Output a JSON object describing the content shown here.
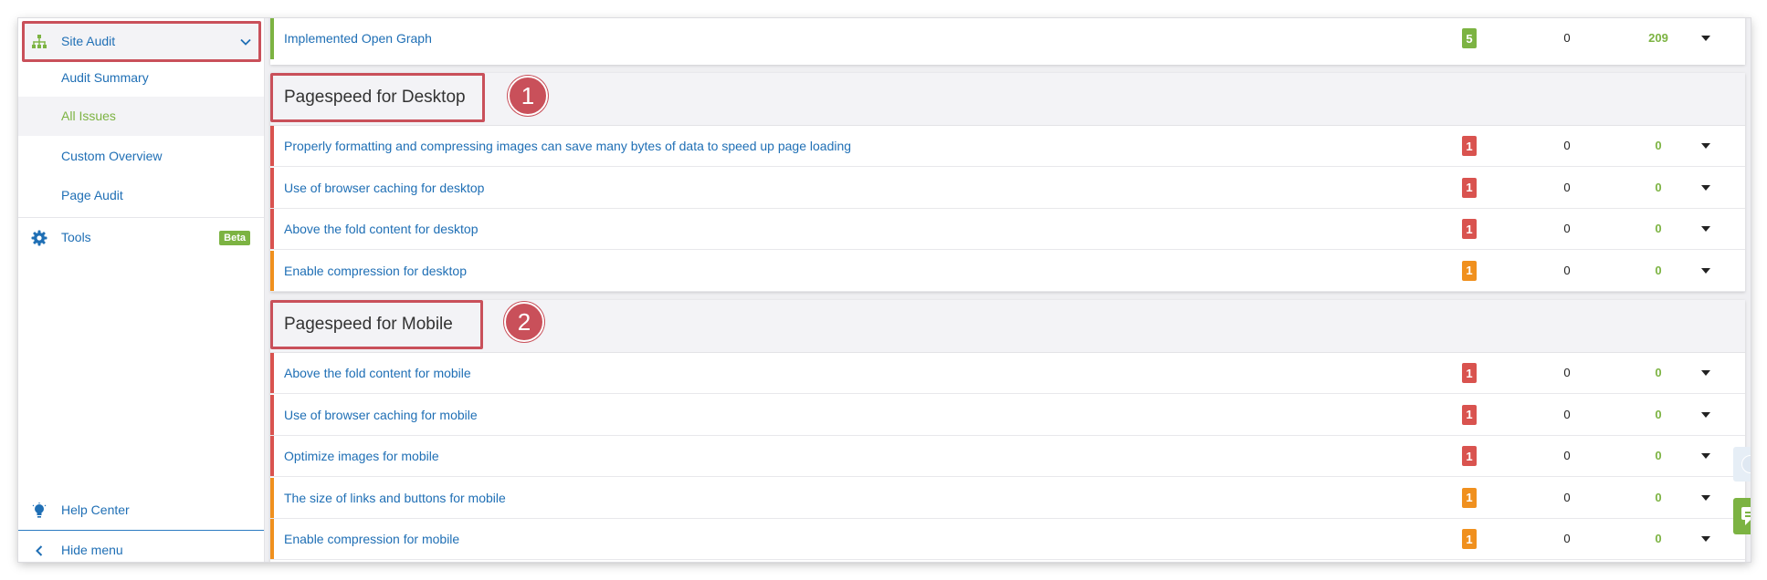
{
  "sidebar": {
    "site_audit": "Site Audit",
    "sub_items": [
      "Audit Summary",
      "All Issues",
      "Custom Overview",
      "Page Audit"
    ],
    "active_item": "All Issues",
    "tools": "Tools",
    "beta": "Beta",
    "help_center": "Help Center",
    "hide_menu": "Hide menu"
  },
  "top_row": {
    "title": "Implemented Open Graph",
    "count": "5",
    "num1": "0",
    "num2": "209",
    "color": "#7cb342"
  },
  "sections": [
    {
      "title": "Pagespeed for Desktop",
      "marker": "1",
      "rows": [
        {
          "title": "Properly formatting and compressing images can save many bytes of data to speed up page loading",
          "count": "1",
          "num1": "0",
          "num2": "0",
          "severity": "error"
        },
        {
          "title": "Use of browser caching for desktop",
          "count": "1",
          "num1": "0",
          "num2": "0",
          "severity": "error"
        },
        {
          "title": "Above the fold content for desktop",
          "count": "1",
          "num1": "0",
          "num2": "0",
          "severity": "error"
        },
        {
          "title": "Enable compression for desktop",
          "count": "1",
          "num1": "0",
          "num2": "0",
          "severity": "warning"
        }
      ]
    },
    {
      "title": "Pagespeed for Mobile",
      "marker": "2",
      "rows": [
        {
          "title": "Above the fold content for mobile",
          "count": "1",
          "num1": "0",
          "num2": "0",
          "severity": "error"
        },
        {
          "title": "Use of browser caching for mobile",
          "count": "1",
          "num1": "0",
          "num2": "0",
          "severity": "error"
        },
        {
          "title": "Optimize images for mobile",
          "count": "1",
          "num1": "0",
          "num2": "0",
          "severity": "error"
        },
        {
          "title": "The size of links and buttons for mobile",
          "count": "1",
          "num1": "0",
          "num2": "0",
          "severity": "warning"
        },
        {
          "title": "Enable compression for mobile",
          "count": "1",
          "num1": "0",
          "num2": "0",
          "severity": "warning"
        }
      ]
    }
  ],
  "colors": {
    "error": "#d9534f",
    "warning": "#f0901e",
    "notice": "#7cb342",
    "link": "#1f6fb5",
    "highlight": "#c9505a"
  },
  "icons": {
    "site_audit": "sitemap-icon",
    "tools": "gear-icon",
    "help_center": "lightbulb-icon",
    "hide_menu": "chevron-left-icon",
    "expand": "chevron-down-icon",
    "row_expand": "caret-down-icon",
    "scroll_top": "scroll-top-icon",
    "chat": "chat-icon"
  }
}
